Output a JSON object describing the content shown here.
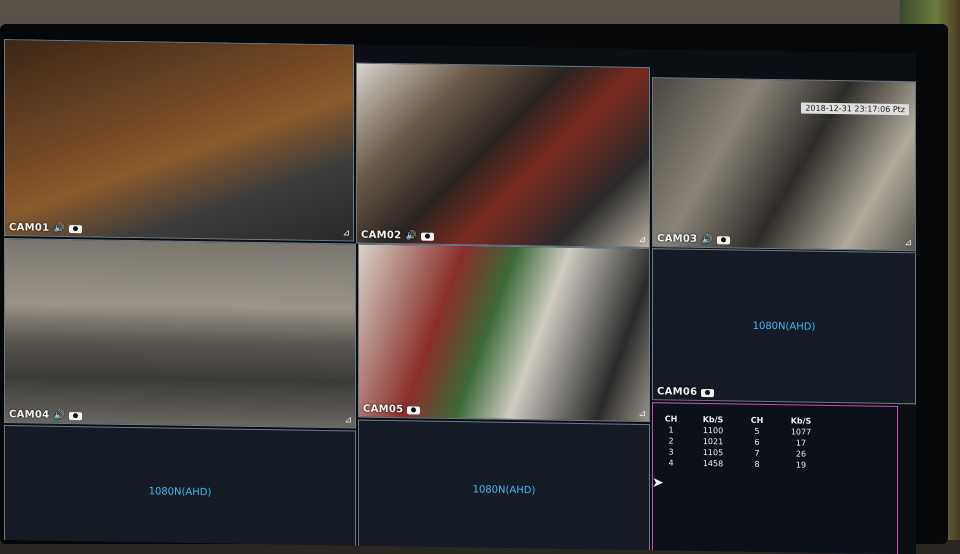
{
  "timestamp": "2018-12-31 23:17:06 Ptz",
  "cameras": [
    {
      "label": "CAM01"
    },
    {
      "label": "CAM02"
    },
    {
      "label": "CAM03"
    },
    {
      "label": "CAM04"
    },
    {
      "label": "CAM05"
    },
    {
      "label": "CAM06"
    }
  ],
  "no_signal_tiles": [
    "1080N(AHD)",
    "1080N(AHD)",
    "1080N(AHD)"
  ],
  "bandwidth": {
    "headers": [
      "CH",
      "Kb/S",
      "CH",
      "Kb/S"
    ],
    "rows": [
      [
        "1",
        "1100",
        "5",
        "1077"
      ],
      [
        "2",
        "1021",
        "6",
        "17"
      ],
      [
        "3",
        "1105",
        "7",
        "26"
      ],
      [
        "4",
        "1458",
        "8",
        "19"
      ]
    ]
  },
  "colors": {
    "border": "#6d7a86",
    "panel_border": "#c44fb4",
    "no_signal_text": "#4ab6f0"
  }
}
